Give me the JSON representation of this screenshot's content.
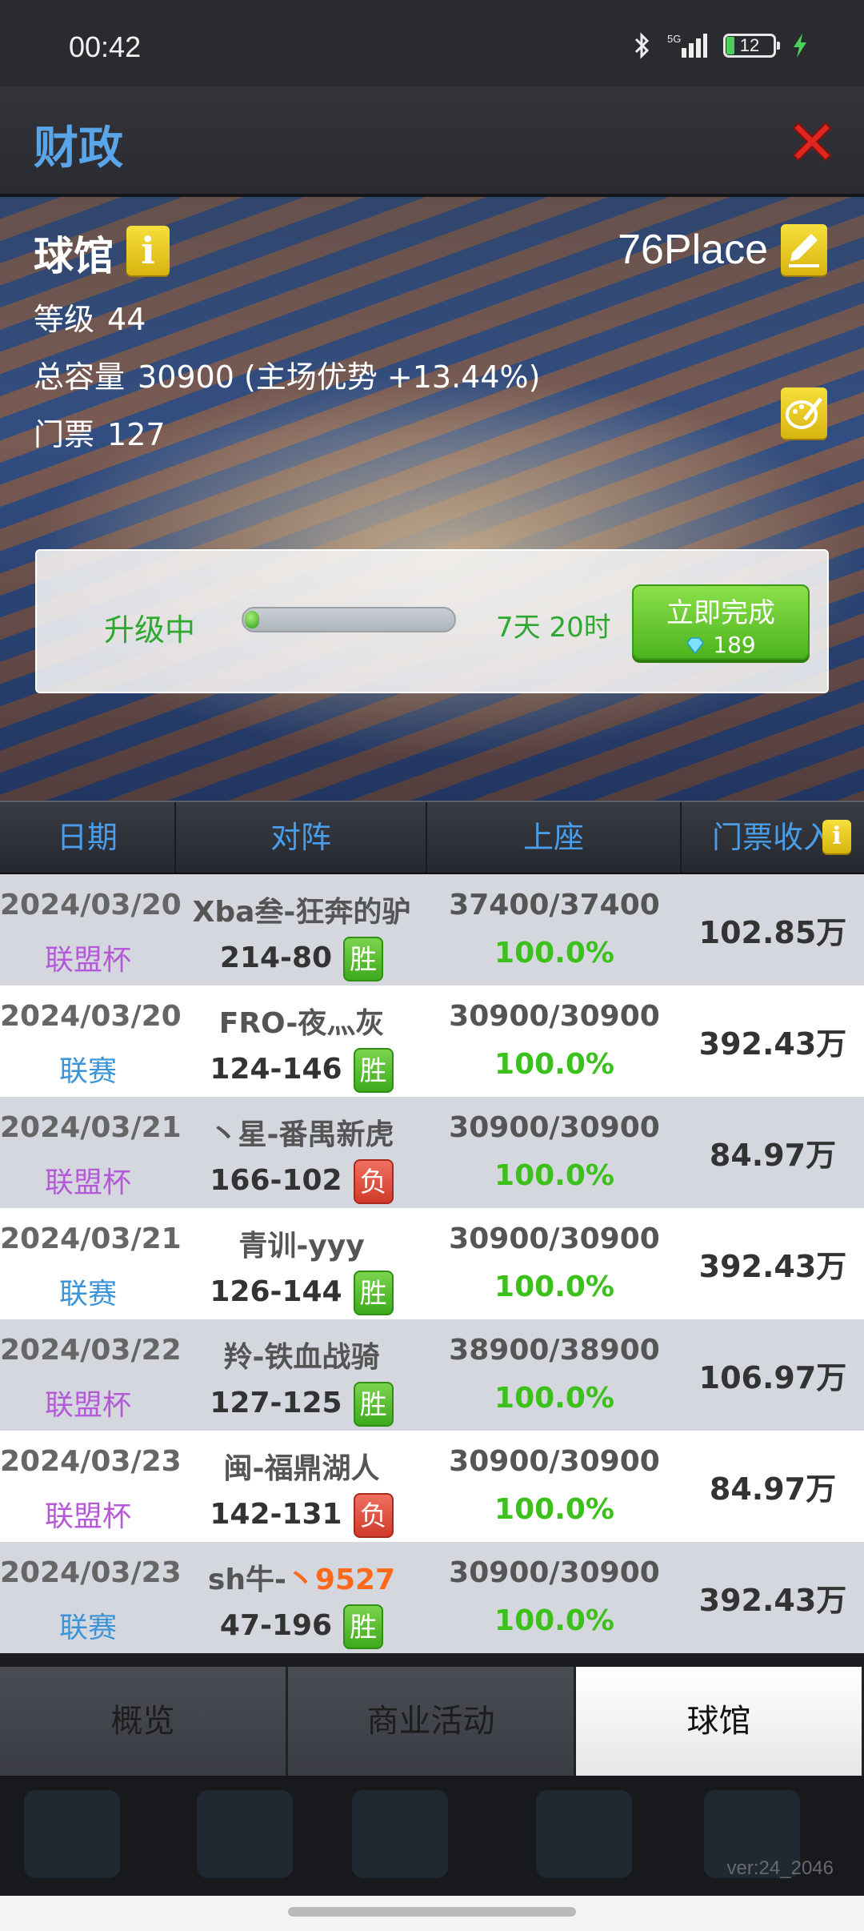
{
  "status_bar": {
    "time": "00:42",
    "network": "5G",
    "battery": "12"
  },
  "header": {
    "title": "财政"
  },
  "arena": {
    "title": "球馆",
    "name": "76Place",
    "level_label": "等级",
    "level_value": "44",
    "capacity_label": "总容量",
    "capacity_value": "30900 (主场优势 +13.44%)",
    "ticket_label": "门票",
    "ticket_value": "127",
    "upgrade": {
      "label": "升级中",
      "progress_fraction": 0.04,
      "remaining": "7天 20时",
      "finish_label": "立即完成",
      "cost": "189"
    }
  },
  "table": {
    "headers": [
      "日期",
      "对阵",
      "上座",
      "门票收入"
    ],
    "rows": [
      {
        "date": "2024/03/20",
        "type": "联盟杯",
        "type_kind": "cup",
        "opponent": "Xba叁-狂奔的驴",
        "opponent_highlight": "",
        "score": "214-80",
        "result": "胜",
        "result_kind": "win",
        "seats": "37400/37400",
        "pct": "100.0%",
        "income": "102.85万"
      },
      {
        "date": "2024/03/20",
        "type": "联赛",
        "type_kind": "league",
        "opponent": "FRO-夜灬灰",
        "opponent_highlight": "",
        "score": "124-146",
        "result": "胜",
        "result_kind": "win",
        "seats": "30900/30900",
        "pct": "100.0%",
        "income": "392.43万"
      },
      {
        "date": "2024/03/21",
        "type": "联盟杯",
        "type_kind": "cup",
        "opponent": "丶星-番禺新虎",
        "opponent_highlight": "",
        "score": "166-102",
        "result": "负",
        "result_kind": "loss",
        "seats": "30900/30900",
        "pct": "100.0%",
        "income": "84.97万"
      },
      {
        "date": "2024/03/21",
        "type": "联赛",
        "type_kind": "league",
        "opponent": "青训-yyy",
        "opponent_highlight": "",
        "score": "126-144",
        "result": "胜",
        "result_kind": "win",
        "seats": "30900/30900",
        "pct": "100.0%",
        "income": "392.43万"
      },
      {
        "date": "2024/03/22",
        "type": "联盟杯",
        "type_kind": "cup",
        "opponent": "羚-铁血战骑",
        "opponent_highlight": "",
        "score": "127-125",
        "result": "胜",
        "result_kind": "win",
        "seats": "38900/38900",
        "pct": "100.0%",
        "income": "106.97万"
      },
      {
        "date": "2024/03/23",
        "type": "联盟杯",
        "type_kind": "cup",
        "opponent": "闽-福鼎湖人",
        "opponent_highlight": "",
        "score": "142-131",
        "result": "负",
        "result_kind": "loss",
        "seats": "30900/30900",
        "pct": "100.0%",
        "income": "84.97万"
      },
      {
        "date": "2024/03/23",
        "type": "联赛",
        "type_kind": "league",
        "opponent": "sh牛-",
        "opponent_highlight": "丶9527",
        "score": "47-196",
        "result": "胜",
        "result_kind": "win",
        "seats": "30900/30900",
        "pct": "100.0%",
        "income": "392.43万"
      }
    ]
  },
  "tabs": [
    "概览",
    "商业活动",
    "球馆"
  ],
  "active_tab": 2,
  "version": "ver:24_2046",
  "colors": {
    "title_blue": "#5aa4e8",
    "win_green": "#3eaa1e",
    "loss_red": "#d03a2a",
    "pct_green": "#3cc01c",
    "cup_purple": "#b45ad8",
    "league_blue": "#3b94d8"
  },
  "icons": [
    "bluetooth-icon",
    "signal-icon",
    "battery-icon",
    "charging-bolt-icon",
    "close-icon",
    "info-icon",
    "edit-name-icon",
    "paint-icon",
    "gem-icon"
  ]
}
